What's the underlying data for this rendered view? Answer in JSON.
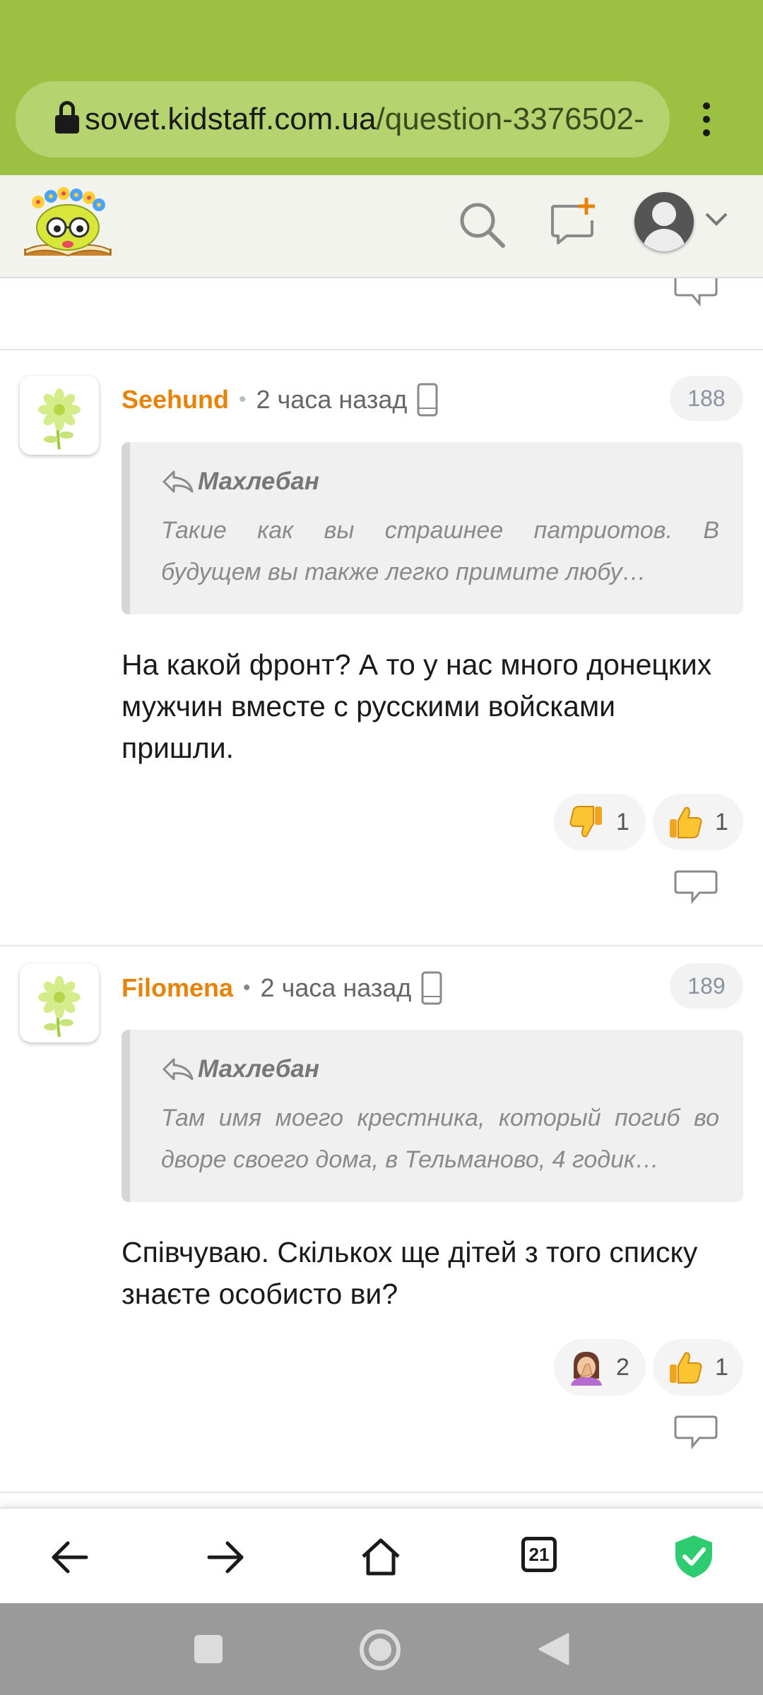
{
  "browser": {
    "url_host": "sovet.kidstaff.com.ua",
    "url_path": "/question-3376502-",
    "tabs_count": "21"
  },
  "comments": [
    {
      "author": "Seehund",
      "time": "2 часа назад",
      "number": "188",
      "quote_author": "Махлебан",
      "quote_line1": "Такие как вы страшнее патриотов. В",
      "quote_line2": "будущем вы также легко примите любу…",
      "body": "На какой фронт? А то у нас много донецких мужчин вместе с русскими войсками пришли.",
      "reactions": [
        {
          "icon": "thumbs-down-icon",
          "count": "1"
        },
        {
          "icon": "thumbs-up-icon",
          "count": "1"
        }
      ]
    },
    {
      "author": "Filomena",
      "time": "2 часа назад",
      "number": "189",
      "quote_author": "Махлебан",
      "quote_line1": "Там имя моего крестника, который погиб во",
      "quote_line2": "дворе своего дома, в Тельманово, 4 годик…",
      "body": "Співчуваю. Скількох ще дітей з того списку знаєте особисто ви?",
      "reactions": [
        {
          "icon": "facepalm-icon",
          "count": "2"
        },
        {
          "icon": "thumbs-up-icon",
          "count": "1"
        }
      ]
    }
  ],
  "colors": {
    "browser_bar": "#9cc042",
    "author": "#e8830a",
    "shield": "#2ecc71"
  }
}
